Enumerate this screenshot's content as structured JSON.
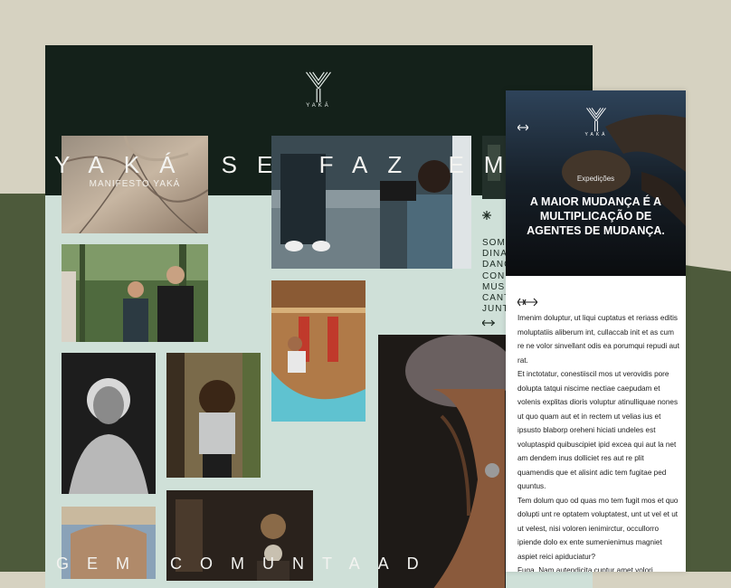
{
  "brand": {
    "name": "YAKÁ"
  },
  "colors": {
    "background_beige": "#d6d2c1",
    "background_olive": "#4d5a3b",
    "desktop_header": "#14211a",
    "desktop_mint": "#cfe0d8",
    "text_dark": "#1c2a22"
  },
  "desktop": {
    "hero_text": "YAKÁ SE FAZ EM RIO",
    "manifesto_label": "MANIFESTO YAKÁ",
    "side_words": [
      "SOMOS",
      "DINAMIZ",
      "DANÇA",
      "CONE",
      "MÚSICA",
      "CANTO",
      "JUNTOS"
    ],
    "bottom_text": "GEM COMUNTAAD",
    "icons": [
      "star-icon",
      "double-arrow-icon"
    ]
  },
  "mobile": {
    "tag": "Expedições",
    "headline": "A MAIOR MUDANÇA É A MULTIPLICAÇÃO DE AGENTES DE MUDANÇA.",
    "paragraphs": [
      "Imenim doluptur, ut liqui cuptatus et reriass editis moluptatiis aliberum int, cullaccab init et as cum re ne volor sinvellant odis ea porumqui repudi aut rat.",
      "Et inctotatur, conestiiscil mos ut verovidis pore dolupta tatqui niscime nectiae caepudam et volenis explitas dioris voluptur atinulliquae nones ut quo quam aut et in rectem ut velias ius et ipsusto blaborp oreheni hiciati undeles est voluptaspid quibuscipiet ipid excea qui aut la net am dendem inus dolliciet res aut re plit quamendis que et alisint adic tem fugitae ped quuntus.",
      "Tem dolum quo od quas mo tem fugit mos et quo dolupti unt re optatem voluptatest, unt ut vel et ut ut velest, nisi voloren ienimirctur, occullorro ipiende dolo ex ente sumenienimus magniet aspiet reici apiduciatur?",
      "Fuga. Nam autendicita cuptur amet volori"
    ]
  }
}
